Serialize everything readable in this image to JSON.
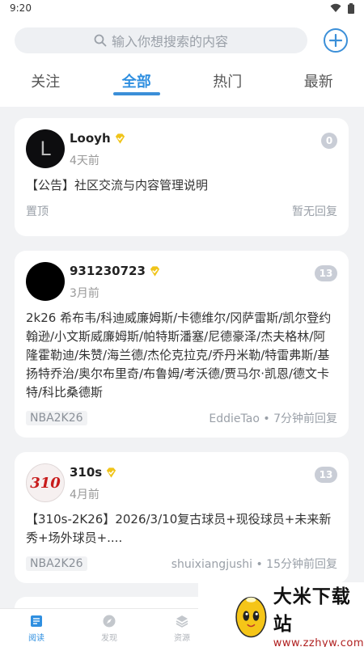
{
  "status": {
    "time": "9:20"
  },
  "search": {
    "placeholder": "输入你想搜索的内容"
  },
  "tabs": [
    {
      "label": "关注",
      "active": false
    },
    {
      "label": "全部",
      "active": true
    },
    {
      "label": "热门",
      "active": false
    },
    {
      "label": "最新",
      "active": false
    }
  ],
  "posts": [
    {
      "username": "Looyh",
      "verified": true,
      "time": "4天前",
      "avatar_letter": "L",
      "reply_count": "0",
      "content": "【公告】社区交流与内容管理说明",
      "tag": "置顶",
      "reply_info": "暂无回复"
    },
    {
      "username": "931230723",
      "verified": true,
      "time": "3月前",
      "reply_count": "13",
      "content": "2k26 希布韦/科迪威廉姆斯/卡德维尔/冈萨雷斯/凯尔登约翰逊/小文斯威廉姆斯/帕特斯潘塞/尼德豪泽/杰夫格林/阿隆霍勒迪/朱赞/海兰德/杰伦克拉克/乔丹米勒/特雷弗斯/基扬特乔治/奥尔布里奇/布鲁姆/考沃德/贾马尔·凯恩/德文卡特/科比桑德斯",
      "tag": "NBA2K26",
      "reply_info": "EddieTao • 7分钟前回复"
    },
    {
      "username": "310s",
      "verified": true,
      "time": "4月前",
      "avatar_text": "310",
      "reply_count": "13",
      "content": "【310s-2K26】2026/3/10复古球员+现役球员+未来新秀+场外球员+....",
      "tag": "NBA2K26",
      "reply_info": "shuixiangjushi • 15分钟前回复"
    }
  ],
  "bottom_nav": [
    {
      "label": "阅读",
      "icon": "book-icon",
      "active": true
    },
    {
      "label": "发现",
      "icon": "compass-icon",
      "active": false
    },
    {
      "label": "资源",
      "icon": "layers-icon",
      "active": false
    }
  ],
  "watermark": {
    "title": "大米下载站",
    "url": "www.zzhyw.com"
  },
  "colors": {
    "accent": "#2f8fe0",
    "badge": "#c9cdd6",
    "verified": "#f0c419"
  }
}
